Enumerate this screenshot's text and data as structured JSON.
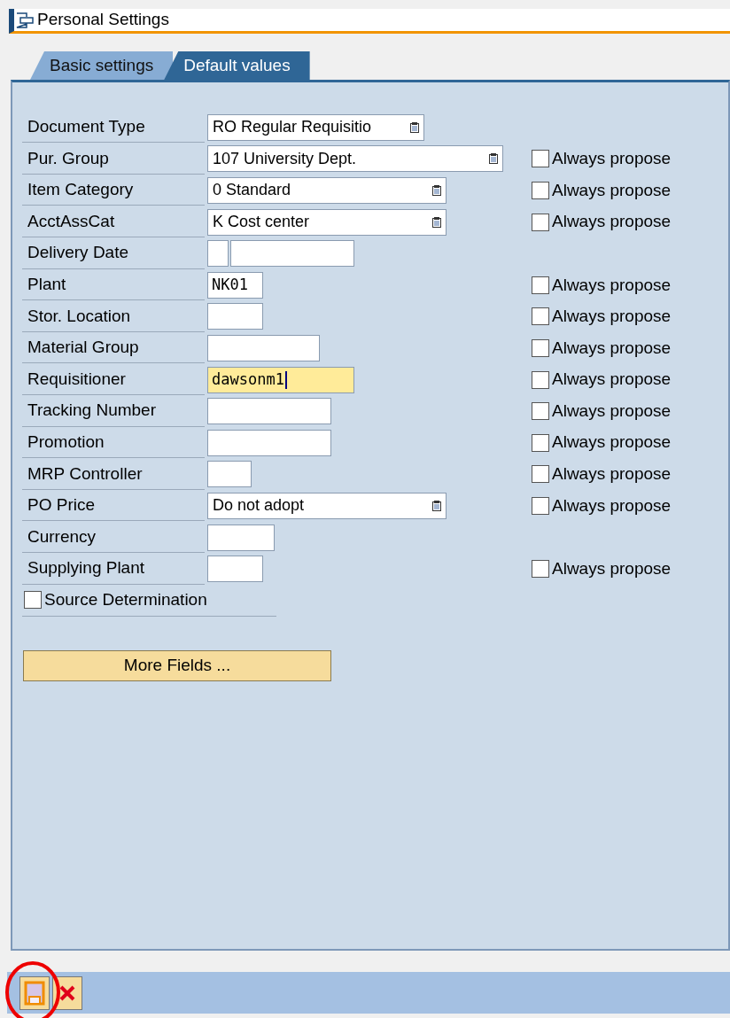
{
  "window": {
    "title": "Personal Settings"
  },
  "tabs": [
    {
      "label": "Basic settings",
      "selected": false
    },
    {
      "label": "Default values",
      "selected": true
    }
  ],
  "fields": [
    {
      "label": "Document Type",
      "kind": "dropdown",
      "value": "RO Regular Requisitio",
      "focused": false
    },
    {
      "label": "Pur. Group",
      "kind": "dropdown",
      "value": "107 University Dept.",
      "focused": false,
      "always_propose": {
        "label": "Always propose",
        "checked": false
      }
    },
    {
      "label": "Item Category",
      "kind": "dropdown",
      "value": "0 Standard",
      "focused": false,
      "always_propose": {
        "label": "Always propose",
        "checked": false
      }
    },
    {
      "label": "AcctAssCat",
      "kind": "dropdown",
      "value": "K Cost center",
      "focused": false,
      "always_propose": {
        "label": "Always propose",
        "checked": false
      }
    },
    {
      "label": "Delivery Date",
      "kind": "date",
      "focused": false
    },
    {
      "label": "Plant",
      "kind": "text",
      "value": "NK01",
      "focused": false,
      "always_propose": {
        "label": "Always propose",
        "checked": false
      }
    },
    {
      "label": "Stor. Location",
      "kind": "text",
      "focused": false,
      "always_propose": {
        "label": "Always propose",
        "checked": false
      }
    },
    {
      "label": "Material Group",
      "kind": "text",
      "focused": false,
      "always_propose": {
        "label": "Always propose",
        "checked": false
      }
    },
    {
      "label": "Requisitioner",
      "kind": "text",
      "value": "dawsonm1",
      "focused": true,
      "always_propose": {
        "label": "Always propose",
        "checked": false
      }
    },
    {
      "label": "Tracking Number",
      "kind": "text",
      "focused": false,
      "always_propose": {
        "label": "Always propose",
        "checked": false
      }
    },
    {
      "label": "Promotion",
      "kind": "text",
      "focused": false,
      "always_propose": {
        "label": "Always propose",
        "checked": false
      }
    },
    {
      "label": "MRP Controller",
      "kind": "text",
      "focused": false,
      "always_propose": {
        "label": "Always propose",
        "checked": false
      }
    },
    {
      "label": "PO Price",
      "kind": "dropdown",
      "value": "Do not adopt",
      "focused": false,
      "always_propose": {
        "label": "Always propose",
        "checked": false
      }
    },
    {
      "label": "Currency",
      "kind": "text",
      "focused": false
    },
    {
      "label": "Supplying Plant",
      "kind": "text",
      "focused": false,
      "always_propose": {
        "label": "Always propose",
        "checked": false
      }
    }
  ],
  "source_determination": {
    "label": "Source Determination",
    "checked": false
  },
  "more_fields_button": "More Fields ...",
  "toolbar": {
    "save_highlighted": true
  }
}
